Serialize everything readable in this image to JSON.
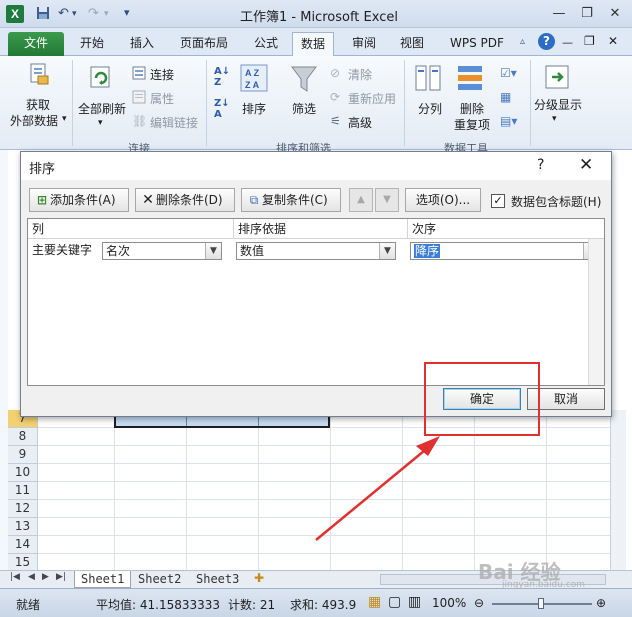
{
  "window": {
    "title": "工作簿1 - Microsoft Excel",
    "app_icon": "X",
    "quick_access": [
      "save-icon",
      "undo-icon",
      "redo-icon",
      "customize-icon"
    ]
  },
  "ribbon_tabs": [
    "文件",
    "开始",
    "插入",
    "页面布局",
    "公式",
    "数据",
    "审阅",
    "视图",
    "WPS PDF"
  ],
  "active_tab": "数据",
  "ribbon": {
    "get_external": "获取",
    "get_external_2": "外部数据",
    "refresh_all": "全部刷新",
    "connections": "连接",
    "properties": "属性",
    "edit_links": "编辑链接",
    "group_connections": "连接",
    "sort": "排序",
    "filter": "筛选",
    "clear": "清除",
    "reapply": "重新应用",
    "advanced": "高级",
    "group_sort_filter": "排序和筛选",
    "text_to_columns": "分列",
    "remove_dup_1": "删除",
    "remove_dup_2": "重复项",
    "group_data_tools": "数据工具",
    "outline": "分级显示"
  },
  "sheet": {
    "rows": [
      "7",
      "8",
      "9",
      "10",
      "11",
      "12",
      "13",
      "14",
      "15"
    ],
    "tabs": [
      "Sheet1",
      "Sheet2",
      "Sheet3"
    ],
    "active_sheet": "Sheet1"
  },
  "statusbar": {
    "ready": "就绪",
    "average": "平均值: 41.15833333",
    "count": "计数: 21",
    "sum": "求和: 493.9",
    "zoom": "100%"
  },
  "dialog": {
    "title": "排序",
    "help": "?",
    "close": "✕",
    "add_level": "添加条件(A)",
    "delete_level": "删除条件(D)",
    "copy_level": "复制条件(C)",
    "options": "选项(O)...",
    "has_headers_label": "数据包含标题(H)",
    "has_headers_checked": true,
    "columns": {
      "col": "列",
      "sort_on": "排序依据",
      "order": "次序"
    },
    "rows": [
      {
        "label": "主要关键字",
        "column": "名次",
        "sort_on": "数值",
        "order": "降序"
      }
    ],
    "ok": "确定",
    "cancel": "取消"
  },
  "watermark": {
    "text": "Bai 经验",
    "sub": "jingyan.baidu.com"
  },
  "colors": {
    "excel_green": "#217a35",
    "highlight_blue": "#3b7ed9",
    "annotation_red": "#e03030"
  }
}
